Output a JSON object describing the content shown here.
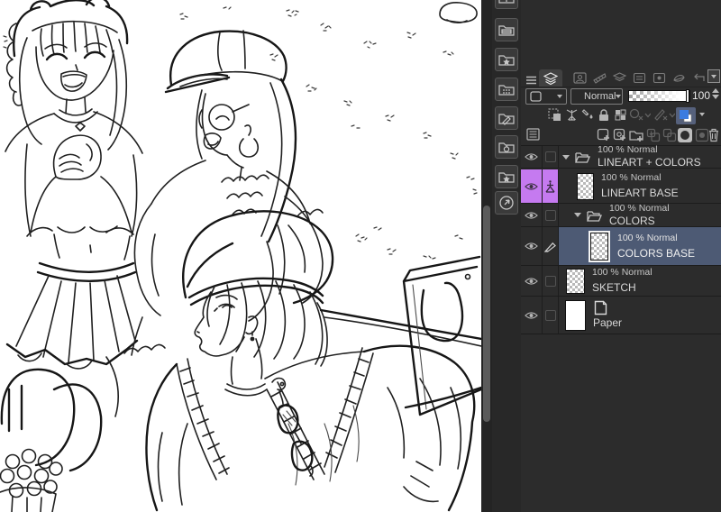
{
  "layer_palette": {
    "blend_mode_value": "Normal",
    "opacity_value": "100",
    "layers": [
      {
        "type": "folder",
        "info": "100 % Normal",
        "name": "LINEART + COLORS",
        "visible": true,
        "expanded": true
      },
      {
        "type": "raster",
        "info": "100 % Normal",
        "name": "LINEART BASE",
        "visible": true,
        "marker": "reference-layer",
        "palette_color": "#c57af0"
      },
      {
        "type": "folder",
        "info": "100 % Normal",
        "name": "COLORS",
        "visible": true,
        "expanded": true
      },
      {
        "type": "raster",
        "info": "100 % Normal",
        "name": "COLORS BASE",
        "visible": true,
        "selected": true,
        "editing": true
      },
      {
        "type": "raster",
        "info": "100 % Normal",
        "name": "SKETCH",
        "visible": true
      },
      {
        "type": "paper",
        "name": "Paper",
        "visible": true
      }
    ],
    "colors": {
      "selected_row": "#4d5a74",
      "layer_palette_purple": "#c57af0",
      "layer_color_swatch_blue": "#3c7ce0",
      "panel_background": "#2c2c2c"
    }
  }
}
